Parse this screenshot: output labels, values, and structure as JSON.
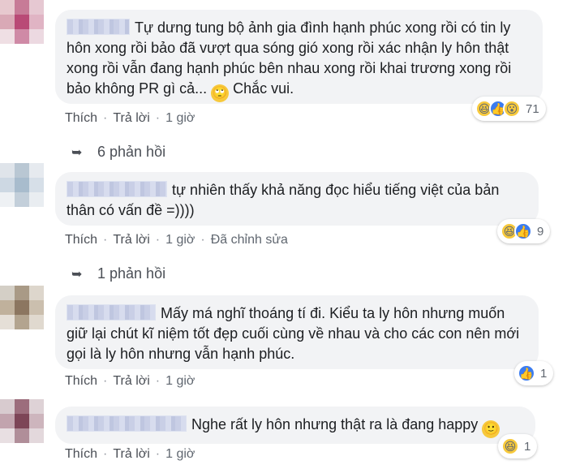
{
  "actions": {
    "like": "Thích",
    "reply": "Trả lời",
    "separator": "·"
  },
  "comments": [
    {
      "text": "Tự dưng tung bộ ảnh gia đình hạnh phúc xong rồi có tin ly hôn xong rồi bảo đã vượt qua sóng gió xong rồi xác nhận ly hôn thật xong rồi vẫn đang hạnh phúc bên nhau xong rồi khai trương xong rồi bảo không PR gì cả...",
      "emoji_text": "🙄",
      "text_tail": " Chắc vui.",
      "time": "1 giờ",
      "reactions": [
        "haha",
        "like",
        "wow"
      ],
      "reaction_count": "71",
      "replies_label": "6 phản hồi"
    },
    {
      "text": "tự nhiên thấy khả năng đọc hiểu tiếng việt của bản thân có vấn đề =))))",
      "time": "1 giờ",
      "edited": "Đã chỉnh sửa",
      "reactions": [
        "haha",
        "like"
      ],
      "reaction_count": "9",
      "replies_label": "1 phản hồi"
    },
    {
      "text": "Mấy má nghĩ thoáng tí đi. Kiểu ta ly hôn nhưng muốn giữ lại chút kĩ niệm tốt đẹp cuối cùng về nhau và cho các con nên mới gọi là ly hôn nhưng vẫn hạnh phúc.",
      "time": "1 giờ",
      "reactions": [
        "like"
      ],
      "reaction_count": "1"
    },
    {
      "text": "Nghe rất ly hôn nhưng thật ra là đang happy",
      "emoji_text": "🙂",
      "time": "1 giờ",
      "reactions": [
        "haha"
      ],
      "reaction_count": "1"
    }
  ],
  "colors": {
    "bubble": "#f2f3f5",
    "like_blue": "#3b7cf0",
    "haha_yellow": "#f7c93c",
    "meta_gray": "#606770"
  },
  "icons": {
    "reply_arrow": "reply-arrow-icon",
    "haha": "haha-reaction-icon",
    "like": "like-reaction-icon",
    "wow": "wow-reaction-icon"
  }
}
